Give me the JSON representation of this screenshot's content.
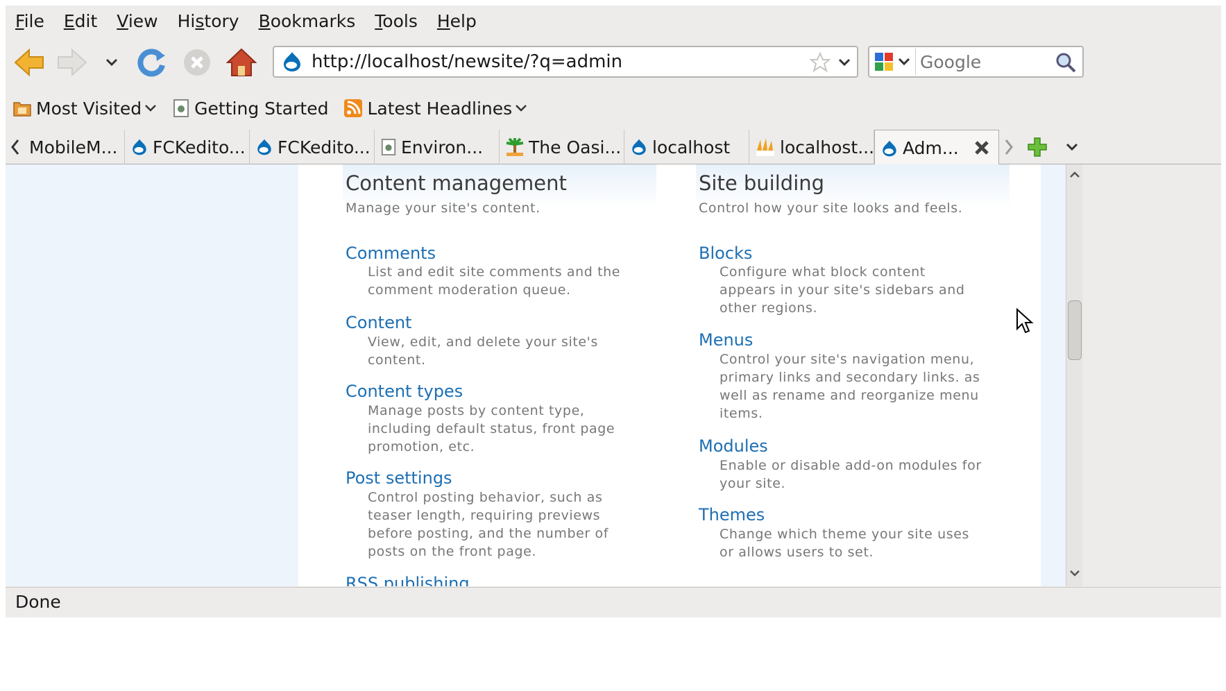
{
  "menubar": {
    "items": [
      {
        "underline": "F",
        "rest": "ile"
      },
      {
        "underline": "E",
        "rest": "dit"
      },
      {
        "underline": "V",
        "rest": "iew"
      },
      {
        "pre": "Hi",
        "underline": "s",
        "rest": "tory"
      },
      {
        "underline": "B",
        "rest": "ookmarks"
      },
      {
        "underline": "T",
        "rest": "ools"
      },
      {
        "underline": "H",
        "rest": "elp"
      }
    ]
  },
  "navbar": {
    "url": "http://localhost/newsite/?q=admin",
    "search_placeholder": "Google"
  },
  "bookmarks": [
    {
      "label": "Most Visited",
      "icon": "folder-icon",
      "dropdown": true
    },
    {
      "label": "Getting Started",
      "icon": "page-icon",
      "dropdown": false
    },
    {
      "label": "Latest Headlines",
      "icon": "rss-icon",
      "dropdown": true
    }
  ],
  "tabs": [
    {
      "label": "MobileM...",
      "icon": "none"
    },
    {
      "label": "FCKedito...",
      "icon": "drupal-icon"
    },
    {
      "label": "FCKedito...",
      "icon": "drupal-icon"
    },
    {
      "label": "Environ...",
      "icon": "page-icon"
    },
    {
      "label": "The Oasi...",
      "icon": "palm-icon"
    },
    {
      "label": "localhost",
      "icon": "drupal-icon"
    },
    {
      "label": "localhost...",
      "icon": "pma-icon"
    },
    {
      "label": "Adm...",
      "icon": "drupal-icon",
      "active": true
    }
  ],
  "content": {
    "left": {
      "title": "Content management",
      "desc": "Manage your site's content.",
      "items": [
        {
          "link": "Comments",
          "desc": [
            "List and edit site comments and the",
            "comment moderation queue."
          ]
        },
        {
          "link": "Content",
          "desc": [
            "View, edit, and delete your site's",
            "content."
          ]
        },
        {
          "link": "Content types",
          "desc": [
            "Manage posts by content type,",
            "including default status, front page",
            "promotion, etc."
          ]
        },
        {
          "link": "Post settings",
          "desc": [
            "Control posting behavior, such as",
            "teaser length, requiring previews",
            "before posting, and the number of",
            "posts on the front page."
          ]
        },
        {
          "link": "RSS publishing",
          "desc": []
        }
      ]
    },
    "right": {
      "title": "Site building",
      "desc": "Control how your site looks and feels.",
      "items": [
        {
          "link": "Blocks",
          "desc": [
            "Configure what block content",
            "appears in your site's sidebars and",
            "other regions."
          ]
        },
        {
          "link": "Menus",
          "desc": [
            "Control your site's navigation menu,",
            "primary links and secondary links. as",
            "well as rename and reorganize menu",
            "items."
          ]
        },
        {
          "link": "Modules",
          "desc": [
            "Enable or disable add-on modules for",
            "your site."
          ]
        },
        {
          "link": "Themes",
          "desc": [
            "Change which theme your site uses",
            "or allows users to set."
          ]
        }
      ]
    }
  },
  "status": "Done",
  "colors": {
    "link": "#1d6fb3",
    "chrome": "#edeceb",
    "sidebar": "#eef4fb"
  }
}
